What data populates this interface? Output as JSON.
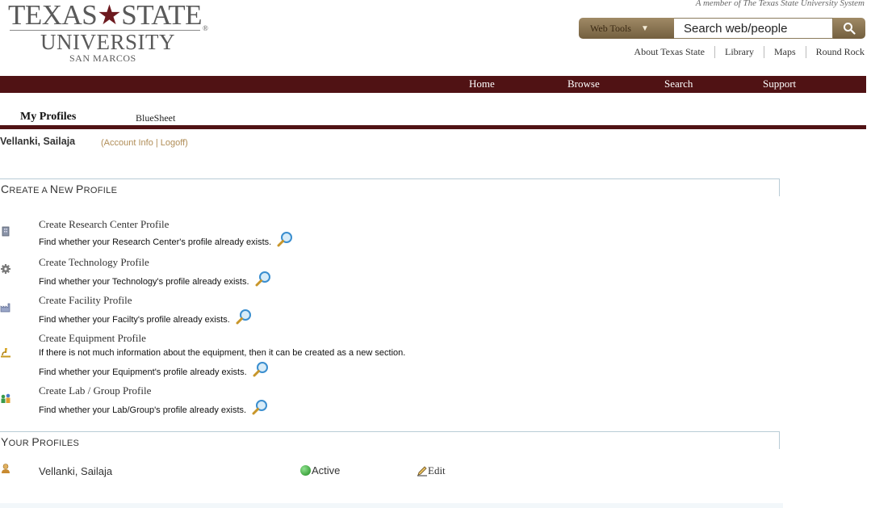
{
  "logo": {
    "line1_left": "TEXAS",
    "line1_right": "STATE",
    "reg": "®",
    "line2": "UNIVERSITY",
    "line3": "SAN MARCOS"
  },
  "member_text": "A member of The Texas State University System",
  "search": {
    "webtools_label": "Web Tools",
    "value": "Search web/people"
  },
  "top_links": [
    "About Texas State",
    "Library",
    "Maps",
    "Round Rock"
  ],
  "nav": [
    "Home",
    "Browse",
    "Search",
    "Support"
  ],
  "tabs": {
    "active": "My Profiles",
    "other": "BlueSheet"
  },
  "user": {
    "name": "Vellanki, Sailaja",
    "account_links": "(Account Info | Logoff)"
  },
  "create_section": {
    "title_caps": "C",
    "title_rest1": "REATE A ",
    "title_caps2": "N",
    "title_rest2": "EW ",
    "title_caps3": "P",
    "title_rest3": "ROFILE",
    "items": [
      {
        "icon": "building-icon",
        "title": "Create Research Center Profile",
        "desc": "Find whether your Research Center's profile already exists."
      },
      {
        "icon": "gear-icon",
        "title": "Create Technology Profile",
        "desc": "Find whether your Technology's profile already exists."
      },
      {
        "icon": "factory-icon",
        "title": "Create Facility Profile",
        "desc": "Find whether your Facilty's profile already exists."
      },
      {
        "icon": "microscope-icon",
        "title": "Create Equipment Profile",
        "note": "If there is not much information about the equipment, then it can be created as a new section.",
        "desc": "Find whether your Equipment's profile already exists."
      },
      {
        "icon": "lab-group-icon",
        "title": "Create Lab / Group Profile",
        "desc": "Find whether your Lab/Group's profile already exists."
      }
    ]
  },
  "your_section": {
    "title_caps": "Y",
    "title_rest1": "OUR ",
    "title_caps2": "P",
    "title_rest2": "ROFILES",
    "profiles": [
      {
        "name": "Vellanki, Sailaja",
        "status": "Active",
        "action": "Edit"
      }
    ]
  },
  "colors": {
    "maroon": "#501214",
    "gold": "#b08d57",
    "section_border": "#b9ccd6"
  }
}
